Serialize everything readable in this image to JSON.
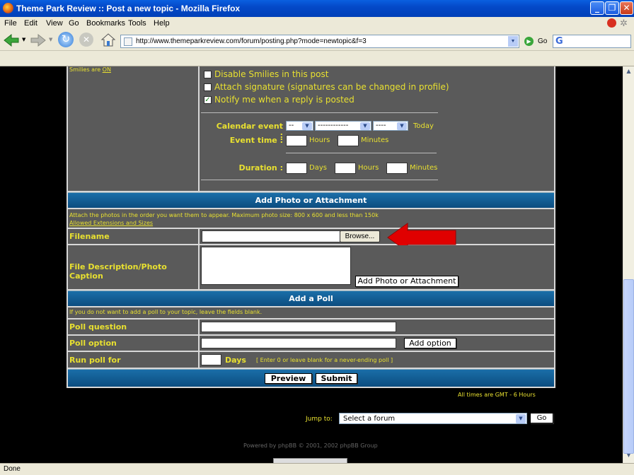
{
  "window": {
    "title": "Theme Park Review :: Post a new topic - Mozilla Firefox"
  },
  "menu": [
    "File",
    "Edit",
    "View",
    "Go",
    "Bookmarks",
    "Tools",
    "Help"
  ],
  "url": "http://www.themeparkreview.com/forum/posting.php?mode=newtopic&f=3",
  "go_label": "Go",
  "options": {
    "smilies_status_prefix": "Smilies are",
    "smilies_status_value": "ON",
    "disable_smilies": "Disable Smilies in this post",
    "attach_signature": "Attach signature (signatures can be changed in profile)",
    "notify_reply": "Notify me when a reply is posted",
    "notify_checked": true
  },
  "calendar": {
    "event_label": "Calendar event :",
    "sel_day": "--",
    "sel_month": "------------",
    "sel_year": "----",
    "today": "Today",
    "time_label": "Event time :",
    "hours": "Hours",
    "minutes": "Minutes",
    "duration_label": "Duration :",
    "days": "Days"
  },
  "attachment": {
    "header": "Add Photo or Attachment",
    "info": "Attach the photos in the order you want them to appear. Maximum photo size: 800 x 600 and less than 150k",
    "allowed_link": "Allowed Extensions and Sizes",
    "filename_label": "Filename",
    "browse": "Browse...",
    "desc_label": "File Description/Photo Caption",
    "add_button": "Add Photo or Attachment"
  },
  "poll": {
    "header": "Add a Poll",
    "info": "If you do not want to add a poll to your topic, leave the fields blank.",
    "question_label": "Poll question",
    "option_label": "Poll option",
    "add_option": "Add option",
    "run_label": "Run poll for",
    "days": "Days",
    "hint": "[ Enter 0 or leave blank for a never-ending poll ]"
  },
  "buttons": {
    "preview": "Preview",
    "submit": "Submit"
  },
  "footer": {
    "times": "All times are GMT - 6 Hours",
    "jump_label": "Jump to:",
    "jump_select": "Select a forum",
    "jump_go": "Go",
    "powered": "Powered by phpBB © 2001, 2002 phpBB Group"
  },
  "status": "Done",
  "colors": {
    "accent_yellow": "#e8e030",
    "header_blue": "#1a6ea8",
    "arrow_red": "#e00000"
  }
}
